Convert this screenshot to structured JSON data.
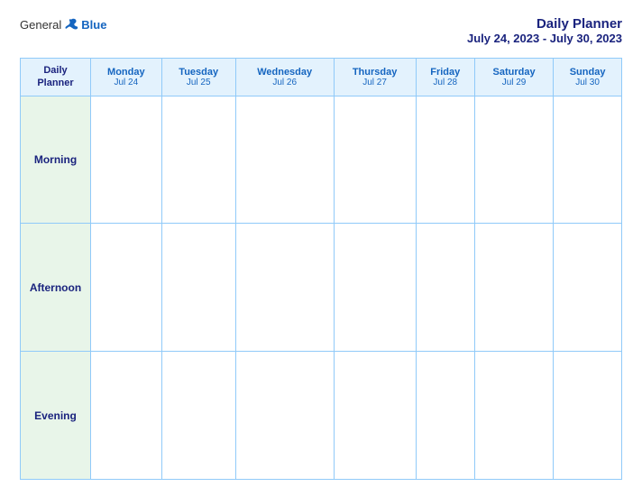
{
  "header": {
    "logo": {
      "general": "General",
      "blue": "Blue",
      "bird_icon": "bird"
    },
    "title": "Daily Planner",
    "date_range": "July 24, 2023 - July 30, 2023"
  },
  "table": {
    "label_header_line1": "Daily",
    "label_header_line2": "Planner",
    "columns": [
      {
        "day": "Monday",
        "date": "Jul 24"
      },
      {
        "day": "Tuesday",
        "date": "Jul 25"
      },
      {
        "day": "Wednesday",
        "date": "Jul 26"
      },
      {
        "day": "Thursday",
        "date": "Jul 27"
      },
      {
        "day": "Friday",
        "date": "Jul 28"
      },
      {
        "day": "Saturday",
        "date": "Jul 29"
      },
      {
        "day": "Sunday",
        "date": "Jul 30"
      }
    ],
    "rows": [
      {
        "label": "Morning"
      },
      {
        "label": "Afternoon"
      },
      {
        "label": "Evening"
      }
    ]
  }
}
